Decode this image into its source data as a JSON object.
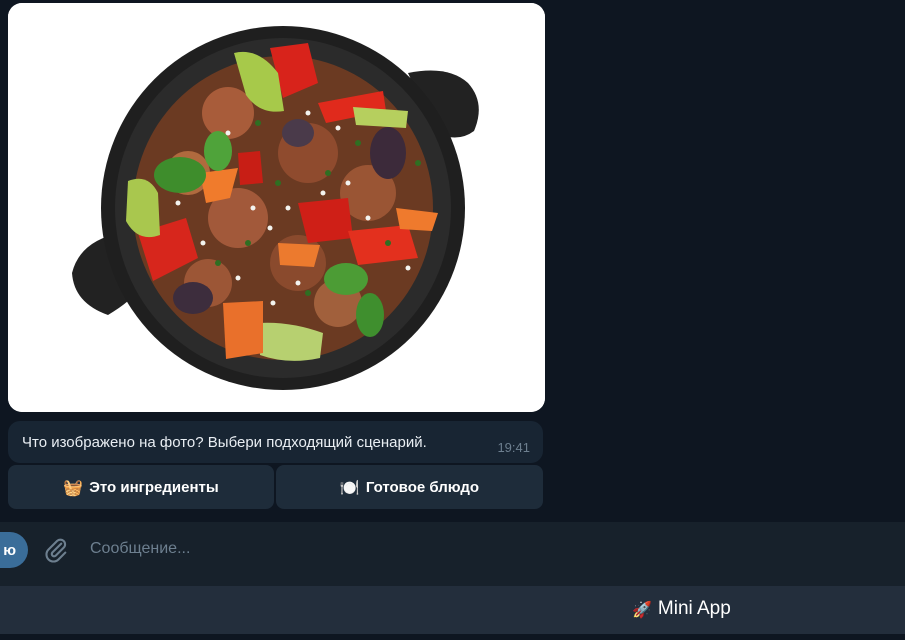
{
  "message": {
    "text": "Что изображено на фото? Выбери подходящий сценарий.",
    "time": "19:41"
  },
  "inline_buttons": [
    {
      "emoji": "🧺",
      "label": "Это ингредиенты"
    },
    {
      "emoji": "🍽️",
      "label": "Готовое блюдо"
    }
  ],
  "input_bar": {
    "menu_label": "ю",
    "placeholder": "Сообщение..."
  },
  "mini_app": {
    "emoji": "🚀",
    "label": "Mini App"
  },
  "colors": {
    "background": "#0e1621",
    "bubble": "#182533",
    "button": "#1e2c3a",
    "input_bar": "#17212b",
    "accent": "#3a6d99"
  },
  "photo": {
    "icon": "food-pan-photo"
  }
}
